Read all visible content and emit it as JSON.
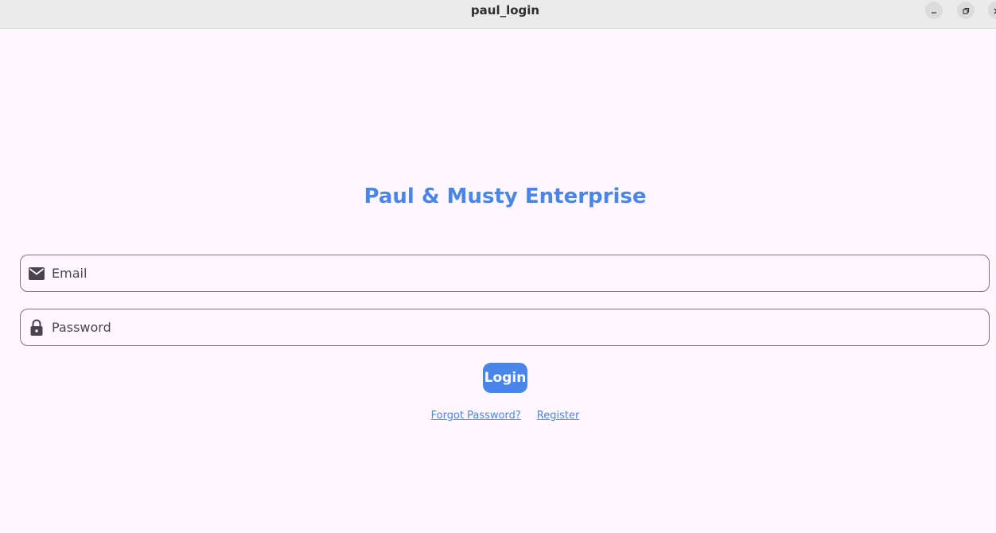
{
  "window": {
    "title": "paul_login",
    "controls": {
      "minimize_icon": "minimize-icon",
      "maximize_icon": "restore-icon",
      "close_icon": "close-icon"
    }
  },
  "app": {
    "title": "Paul & Musty Enterprise",
    "accent_color": "#4a86e8",
    "background_color": "#fef7ff"
  },
  "form": {
    "email": {
      "placeholder": "Email",
      "value": "",
      "icon": "mail-icon"
    },
    "password": {
      "placeholder": "Password",
      "value": "",
      "icon": "lock-icon"
    },
    "login_label": "Login"
  },
  "links": {
    "forgot_password": "Forgot Password?",
    "register": "Register"
  }
}
